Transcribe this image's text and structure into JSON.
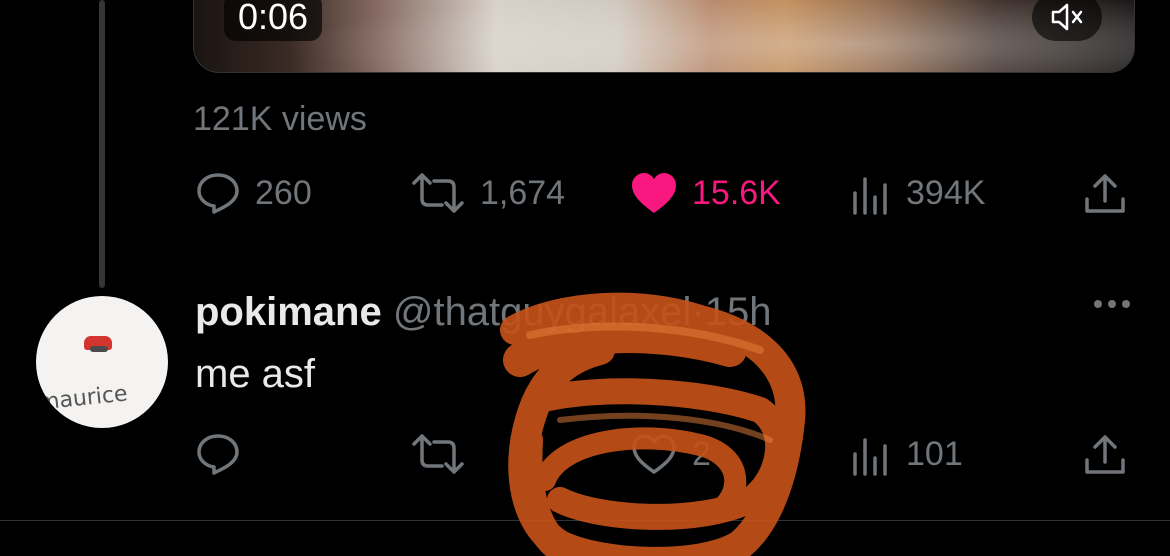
{
  "video": {
    "timestamp": "0:06",
    "mute_icon": "speaker-muted-icon"
  },
  "tweet": {
    "views": "121K views",
    "actions": {
      "reply_count": "260",
      "retweet_count": "1,674",
      "like_count": "15.6K",
      "view_count": "394K"
    }
  },
  "reply": {
    "avatar_text": "maurice",
    "display_name": "pokimane",
    "handle": "@thatguygalaxel",
    "separator": "·",
    "time": "15h",
    "text": "me asf",
    "actions": {
      "like_count": "2",
      "view_count": "101"
    }
  },
  "colors": {
    "like_pink": "#f91880",
    "muted_gray": "#71767b",
    "background": "#000000",
    "scribble_orange": "#c4521a"
  }
}
